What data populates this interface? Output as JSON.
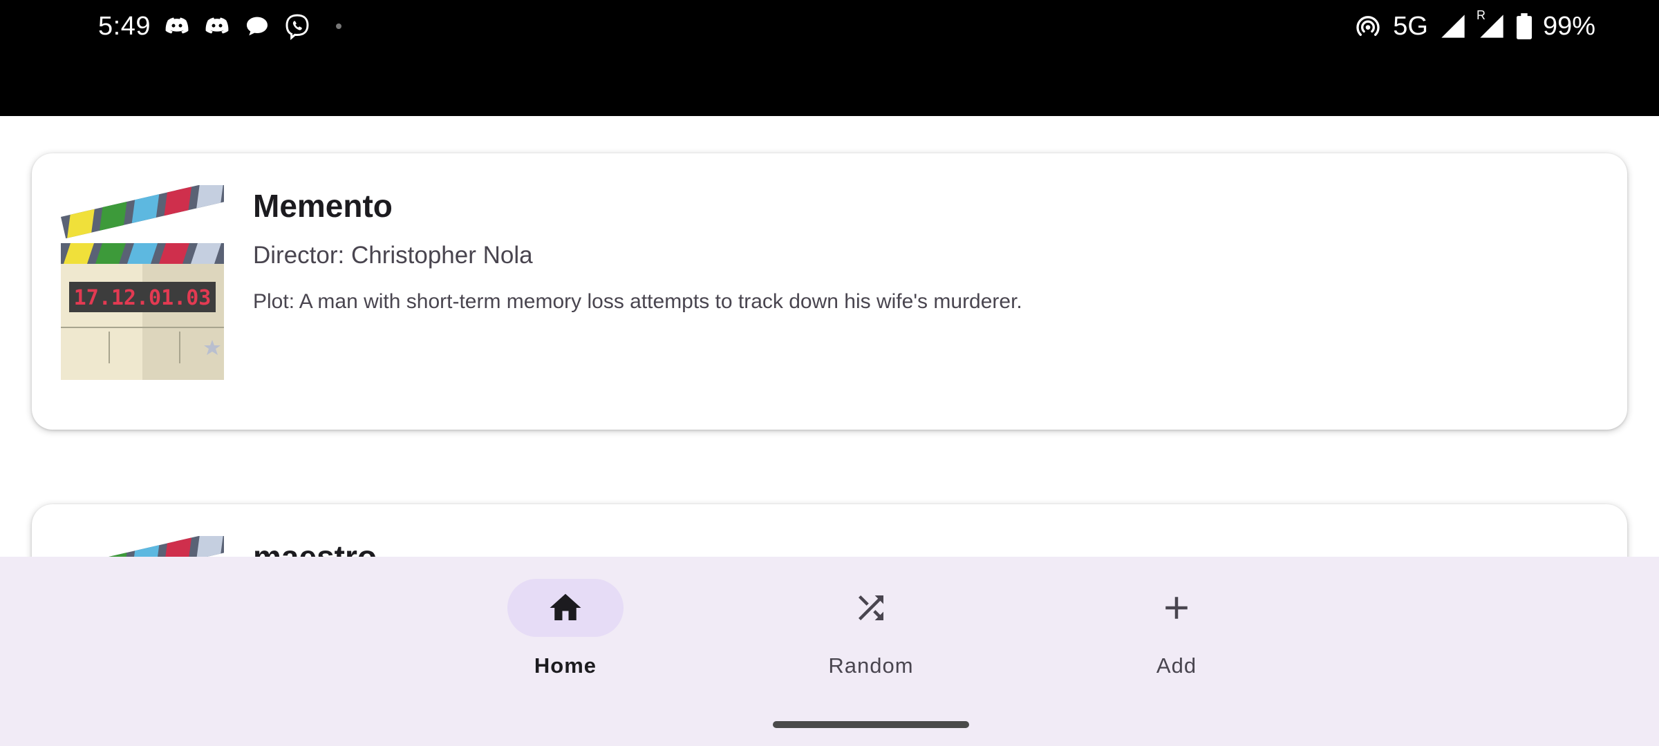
{
  "status_bar": {
    "time": "5:49",
    "network": "5G",
    "roaming": "R",
    "battery": "99%",
    "left_icons": [
      "discord-icon",
      "discord-icon",
      "chat-bubble-icon",
      "viber-icon"
    ],
    "right_icons": [
      "hotspot-icon",
      "signal-icon",
      "signal-roaming-icon",
      "battery-icon"
    ]
  },
  "movies": [
    {
      "title": "Memento",
      "director": "Director: Christopher Nola",
      "plot": "Plot: A man with short-term memory loss attempts to track down his wife's murderer.",
      "poster_text": "17.12.01.03"
    },
    {
      "title": "maestro"
    }
  ],
  "nav": {
    "items": [
      {
        "label": "Home",
        "icon": "home-icon",
        "active": true
      },
      {
        "label": "Random",
        "icon": "shuffle-icon",
        "active": false
      },
      {
        "label": "Add",
        "icon": "plus-icon",
        "active": false
      }
    ]
  },
  "colors": {
    "nav_background": "#f1ebf6",
    "nav_active_pill": "#e6dcf6",
    "status_background": "#000000"
  }
}
